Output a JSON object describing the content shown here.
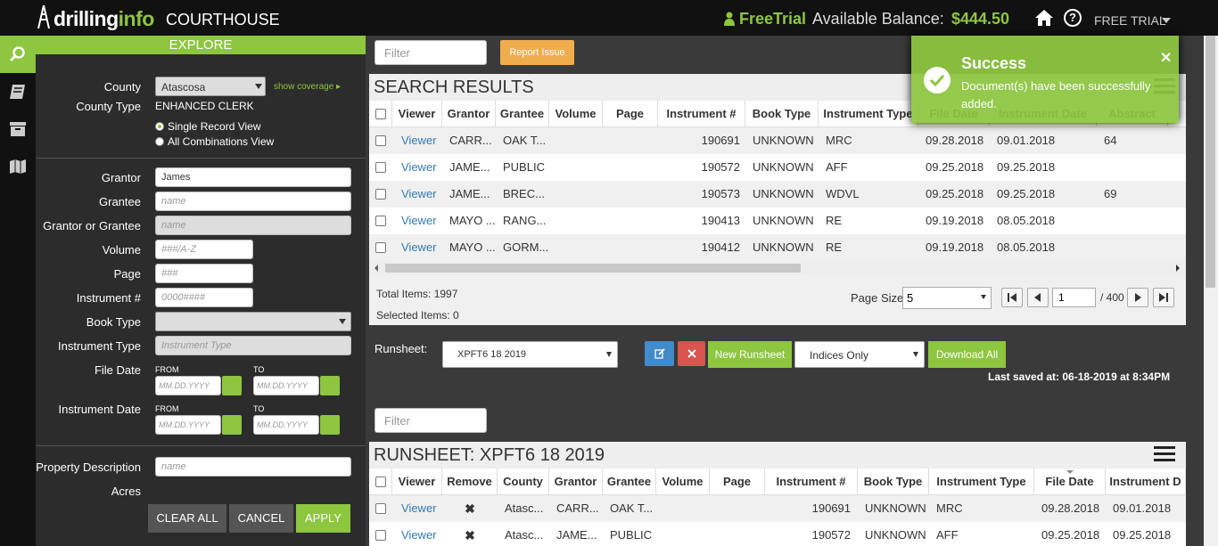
{
  "header": {
    "logo_part1": "drilling",
    "logo_part2": "info",
    "app_name": "COURTHOUSE",
    "free_trial_label": "FreeTrial",
    "balance_label": "Available Balance:",
    "balance_value": "$444.50",
    "plan_menu_label": "FREE TRIAL"
  },
  "nav": {
    "items": [
      {
        "icon": "search-icon",
        "active": true
      },
      {
        "icon": "book-icon",
        "active": false
      },
      {
        "icon": "archive-box-icon",
        "active": false
      },
      {
        "icon": "map-icon",
        "active": false
      }
    ]
  },
  "explore": {
    "title": "EXPLORE",
    "county_label": "County",
    "county_value": "Atascosa",
    "show_coverage": "show coverage",
    "county_type_label": "County Type",
    "county_type_value": "ENHANCED CLERK",
    "view_options": [
      "Single Record View",
      "All Combinations View"
    ],
    "grantor_label": "Grantor",
    "grantor_value": "James",
    "grantee_label": "Grantee",
    "grantee_placeholder": "name",
    "grantor_or_grantee_label": "Grantor or Grantee",
    "grantor_or_grantee_placeholder": "name",
    "volume_label": "Volume",
    "volume_placeholder": "###/A-Z",
    "page_label": "Page",
    "page_placeholder": "###",
    "instrument_no_label": "Instrument #",
    "instrument_no_placeholder": "0000####",
    "book_type_label": "Book Type",
    "instrument_type_label": "Instrument Type",
    "instrument_type_placeholder": "Instrument Type",
    "file_date_label": "File Date",
    "instrument_date_label": "Instrument Date",
    "from_label": "FROM",
    "to_label": "TO",
    "date_placeholder": "MM.DD.YYYY",
    "property_description_label": "Property Description",
    "property_description_placeholder": "name",
    "acres_label": "Acres",
    "clear_all": "CLEAR ALL",
    "cancel": "CANCEL",
    "apply": "APPLY"
  },
  "search_results": {
    "filter_placeholder": "Filter",
    "report_issue": "Report Issue",
    "title": "SEARCH RESULTS",
    "columns": [
      "Viewer",
      "Grantor",
      "Grantee",
      "Volume",
      "Page",
      "Instrument #",
      "Book Type",
      "Instrument Type",
      "File Date",
      "Instrument Date",
      "Abstract"
    ],
    "rows": [
      {
        "viewer": "Viewer",
        "grantor": "CARR...",
        "grantee": "OAK T...",
        "volume": "",
        "page": "",
        "instrument": "190691",
        "book_type": "UNKNOWN",
        "instrument_type": "MRC",
        "file_date": "09.28.2018",
        "instrument_date": "09.01.2018",
        "abstract": "64"
      },
      {
        "viewer": "Viewer",
        "grantor": "JAME...",
        "grantee": "PUBLIC",
        "volume": "",
        "page": "",
        "instrument": "190572",
        "book_type": "UNKNOWN",
        "instrument_type": "AFF",
        "file_date": "09.25.2018",
        "instrument_date": "09.25.2018",
        "abstract": ""
      },
      {
        "viewer": "Viewer",
        "grantor": "JAME...",
        "grantee": "BREC...",
        "volume": "",
        "page": "",
        "instrument": "190573",
        "book_type": "UNKNOWN",
        "instrument_type": "WDVL",
        "file_date": "09.25.2018",
        "instrument_date": "09.25.2018",
        "abstract": "69"
      },
      {
        "viewer": "Viewer",
        "grantor": "MAYO ...",
        "grantee": "RANG...",
        "volume": "",
        "page": "",
        "instrument": "190413",
        "book_type": "UNKNOWN",
        "instrument_type": "RE",
        "file_date": "09.19.2018",
        "instrument_date": "08.05.2018",
        "abstract": ""
      },
      {
        "viewer": "Viewer",
        "grantor": "MAYO ...",
        "grantee": "GORM...",
        "volume": "",
        "page": "",
        "instrument": "190412",
        "book_type": "UNKNOWN",
        "instrument_type": "RE",
        "file_date": "09.19.2018",
        "instrument_date": "08.05.2018",
        "abstract": ""
      }
    ],
    "total_items": "Total Items: 1997",
    "selected_items": "Selected Items: 0",
    "page_size_label": "Page Size:",
    "page_size_value": "5",
    "current_page": "1",
    "total_pages": "/ 400"
  },
  "runsheet_bar": {
    "label": "Runsheet:",
    "selected": "XPFT6 18 2019",
    "new_runsheet": "New Runsheet",
    "indices_option": "Indices Only",
    "download_all": "Download All",
    "last_saved": "Last saved at: 06-18-2019 at 8:34PM"
  },
  "runsheet": {
    "filter_placeholder": "Filter",
    "title": "RUNSHEET: XPFT6 18 2019",
    "columns": [
      "Viewer",
      "Remove",
      "County",
      "Grantor",
      "Grantee",
      "Volume",
      "Page",
      "Instrument #",
      "Book Type",
      "Instrument Type",
      "File Date",
      "Instrument D"
    ],
    "rows": [
      {
        "viewer": "Viewer",
        "county": "Atasc...",
        "grantor": "CARR...",
        "grantee": "OAK T...",
        "volume": "",
        "page": "",
        "instrument": "190691",
        "book_type": "UNKNOWN",
        "instrument_type": "MRC",
        "file_date": "09.28.2018",
        "instrument_date": "09.01.2018"
      },
      {
        "viewer": "Viewer",
        "county": "Atasc...",
        "grantor": "JAME...",
        "grantee": "PUBLIC",
        "volume": "",
        "page": "",
        "instrument": "190572",
        "book_type": "UNKNOWN",
        "instrument_type": "AFF",
        "file_date": "09.25.2018",
        "instrument_date": "09.25.2018"
      }
    ]
  },
  "toast": {
    "title": "Success",
    "message": "Document(s) have been successfully added."
  },
  "colors": {
    "brand_green": "#8dc63f",
    "report_orange": "#f0ad4e",
    "edit_blue": "#428bca",
    "delete_red": "#d9534f",
    "link_blue": "#337ab7"
  }
}
